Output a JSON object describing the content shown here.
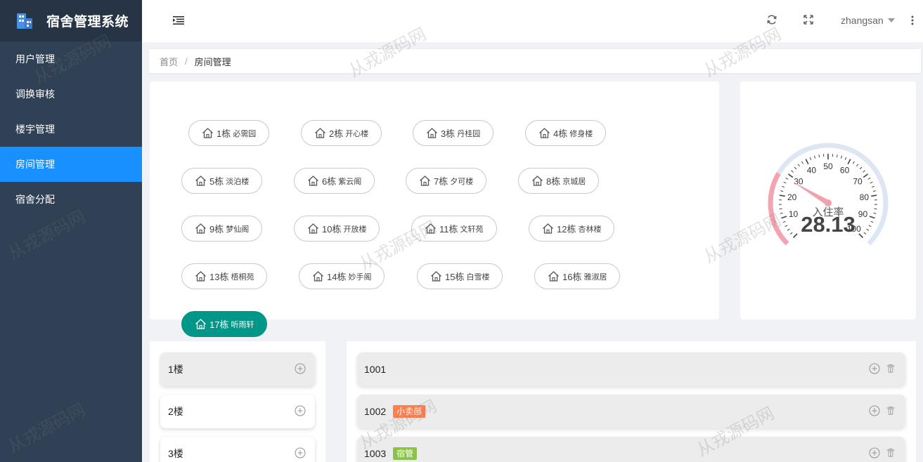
{
  "app": {
    "title": "宿舍管理系统"
  },
  "sidebar": {
    "items": [
      {
        "label": "用户管理",
        "active": false
      },
      {
        "label": "调换审核",
        "active": false
      },
      {
        "label": "楼宇管理",
        "active": false
      },
      {
        "label": "房间管理",
        "active": true
      },
      {
        "label": "宿舍分配",
        "active": false
      }
    ]
  },
  "header": {
    "username": "zhangsan"
  },
  "breadcrumb": {
    "home": "首页",
    "separator": "/",
    "current": "房间管理"
  },
  "buildings": [
    {
      "num": "1栋",
      "name": "必需园"
    },
    {
      "num": "2栋",
      "name": "开心楼"
    },
    {
      "num": "3栋",
      "name": "丹桂园"
    },
    {
      "num": "4栋",
      "name": "修身楼"
    },
    {
      "num": "5栋",
      "name": "淡泊楼"
    },
    {
      "num": "6栋",
      "name": "紫云阁"
    },
    {
      "num": "7栋",
      "name": "夕可楼"
    },
    {
      "num": "8栋",
      "name": "京城居"
    },
    {
      "num": "9栋",
      "name": "梦仙阁"
    },
    {
      "num": "10栋",
      "name": "开放楼"
    },
    {
      "num": "11栋",
      "name": "文轩苑"
    },
    {
      "num": "12栋",
      "name": "杏林楼"
    },
    {
      "num": "13栋",
      "name": "梧桐苑"
    },
    {
      "num": "14栋",
      "name": "妙手阁"
    },
    {
      "num": "15栋",
      "name": "白雪楼"
    },
    {
      "num": "16栋",
      "name": "雅淑居"
    },
    {
      "num": "17栋",
      "name": "听雨轩",
      "active": true
    }
  ],
  "gauge": {
    "label": "入住率",
    "value": 28.13,
    "value_text": "28.13",
    "min": 0,
    "max": 100,
    "tick_labels": [
      "10",
      "20",
      "30",
      "40",
      "50",
      "60",
      "70",
      "80",
      "90",
      "100"
    ],
    "filled_color": "#f5a3b0",
    "rest_color": "#dfe6f3",
    "pointer_color": "#f4a0ad"
  },
  "floors": [
    {
      "label": "1楼",
      "active": true
    },
    {
      "label": "2楼",
      "active": false
    },
    {
      "label": "3楼",
      "active": false
    }
  ],
  "rooms": [
    {
      "number": "1001",
      "tag": null
    },
    {
      "number": "1002",
      "tag": "小卖部",
      "tag_color": "#ff7f4f"
    },
    {
      "number": "1003",
      "tag": "宿管",
      "tag_color": "#8bc34a"
    }
  ],
  "watermark": "从戎源码网",
  "colors": {
    "sidebar": "#304156",
    "active_menu": "#1890ff",
    "active_building": "#009688"
  }
}
